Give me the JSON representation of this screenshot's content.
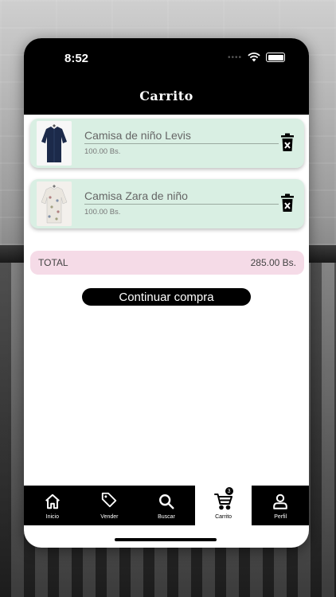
{
  "status_bar": {
    "time": "8:52",
    "signal": "••••"
  },
  "header": {
    "title": "Carrito"
  },
  "cart": {
    "items": [
      {
        "name": "Camisa de niño Levis",
        "price": "100.00 Bs.",
        "image": "shirt-navy-image"
      },
      {
        "name": "Camisa Zara de niño",
        "price": "100.00 Bs.",
        "image": "shirt-floral-image"
      }
    ],
    "total_label": "TOTAL",
    "total_value": "285.00 Bs.",
    "continue_label": "Continuar compra"
  },
  "tabbar": {
    "items": [
      {
        "label": "Inicio",
        "icon": "home-icon"
      },
      {
        "label": "Vender",
        "icon": "tag-icon"
      },
      {
        "label": "Buscar",
        "icon": "search-icon"
      },
      {
        "label": "Carrito",
        "icon": "cart-icon",
        "active": true,
        "badge": "3"
      },
      {
        "label": "Perfil",
        "icon": "user-icon"
      }
    ]
  },
  "colors": {
    "header_bg": "#000000",
    "item_bg": "#d9efe3",
    "total_bg": "#f5dbe7",
    "button_bg": "#000000"
  }
}
